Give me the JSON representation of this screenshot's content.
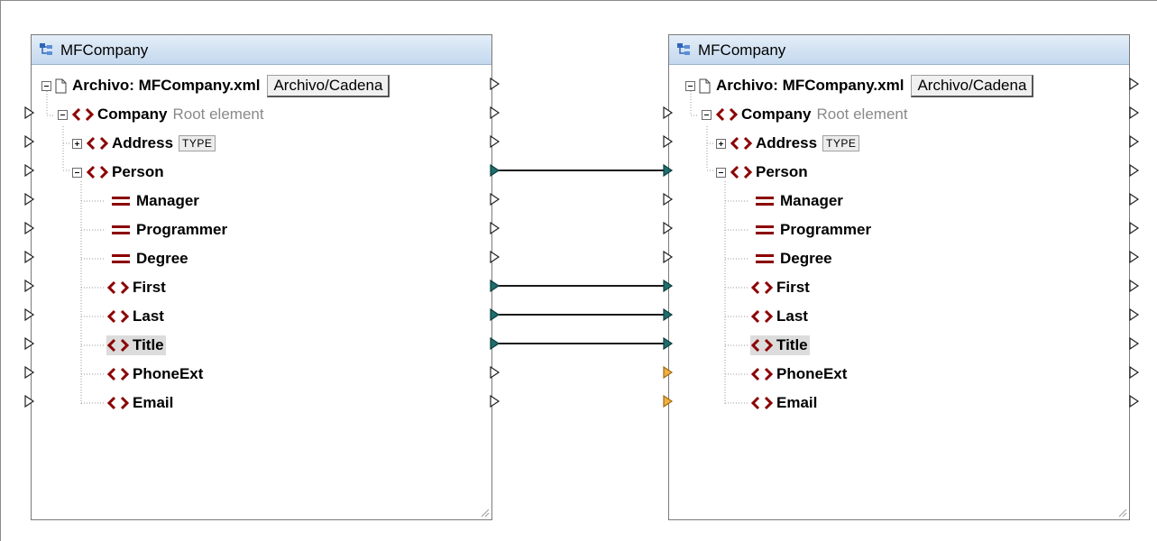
{
  "colors": {
    "accent": "#1f6e6e",
    "element": "#8b0000",
    "port_orange": "#f0b040",
    "header_gradient_top": "#e4eef8",
    "header_gradient_bottom": "#c4d8ee"
  },
  "source": {
    "title": "MFCompany",
    "file_label": "Archivo: MFCompany.xml",
    "file_button": "Archivo/Cadena",
    "root": {
      "name": "Company",
      "note": "Root element"
    },
    "address": {
      "name": "Address",
      "type_tag": "TYPE"
    },
    "person": "Person",
    "attributes": [
      "Manager",
      "Programmer",
      "Degree"
    ],
    "elements": [
      "First",
      "Last",
      "Title",
      "PhoneExt",
      "Email"
    ]
  },
  "target": {
    "title": "MFCompany",
    "file_label": "Archivo: MFCompany.xml",
    "file_button": "Archivo/Cadena",
    "root": {
      "name": "Company",
      "note": "Root element"
    },
    "address": {
      "name": "Address",
      "type_tag": "TYPE"
    },
    "person": "Person",
    "attributes": [
      "Manager",
      "Programmer",
      "Degree"
    ],
    "elements": [
      "First",
      "Last",
      "Title",
      "PhoneExt",
      "Email"
    ]
  },
  "connections": [
    "Person",
    "First",
    "Last",
    "Title"
  ],
  "selected_item": "Title",
  "icons": {
    "component": "component-icon",
    "document": "document-icon",
    "element": "element-icon",
    "attribute": "attribute-icon",
    "port": "port-triangle-icon"
  }
}
